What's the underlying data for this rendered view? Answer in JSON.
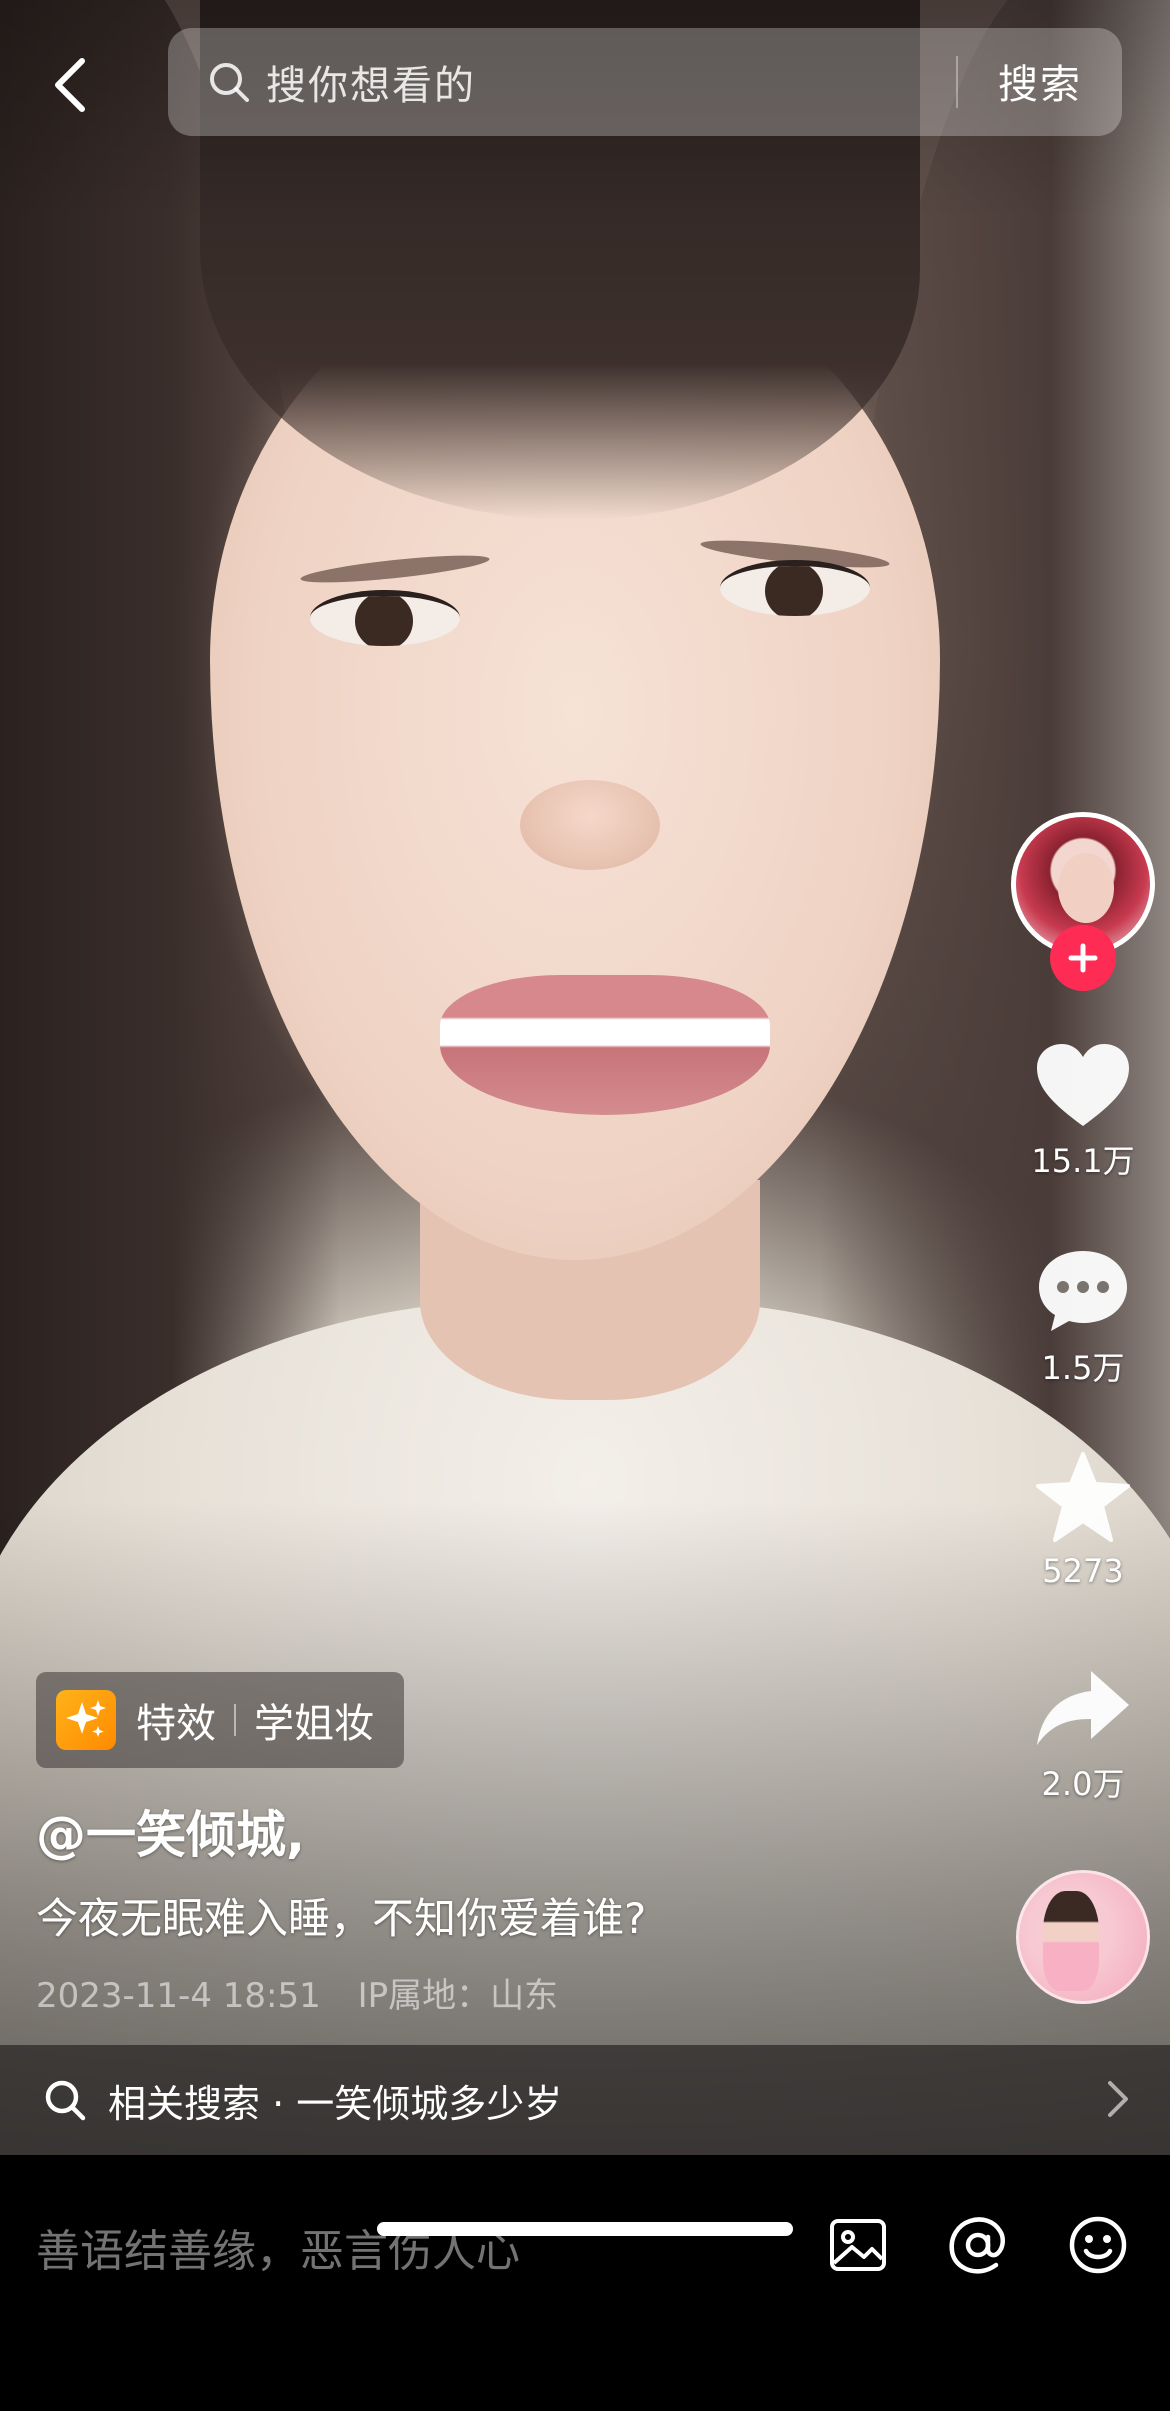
{
  "search": {
    "placeholder": "搜你想看的",
    "button_label": "搜索"
  },
  "icons": {
    "back": "chevron-left-icon",
    "search": "search-icon",
    "like": "heart-icon",
    "comment": "comment-icon",
    "favorite": "star-icon",
    "share": "share-icon",
    "follow": "plus-icon",
    "image": "image-icon",
    "mention": "at-icon",
    "emoji": "emoji-icon"
  },
  "actions": {
    "likes": "15.1万",
    "comments": "1.5万",
    "favorites": "5273",
    "shares": "2.0万"
  },
  "effect": {
    "label": "特效",
    "name": "学姐妆"
  },
  "post": {
    "author": "@一笑倾城,",
    "caption": "今夜无眠难入睡，不知你爱着谁?",
    "date": "2023-11-4 18:51",
    "ip_location": "IP属地：山东"
  },
  "related_search": {
    "text": "相关搜索 · 一笑倾城多少岁"
  },
  "comment_bar": {
    "placeholder": "善语结善缘，恶言伤人心"
  },
  "colors": {
    "follow_accent": "#fe2c55",
    "effect_icon": "#ffa000"
  }
}
